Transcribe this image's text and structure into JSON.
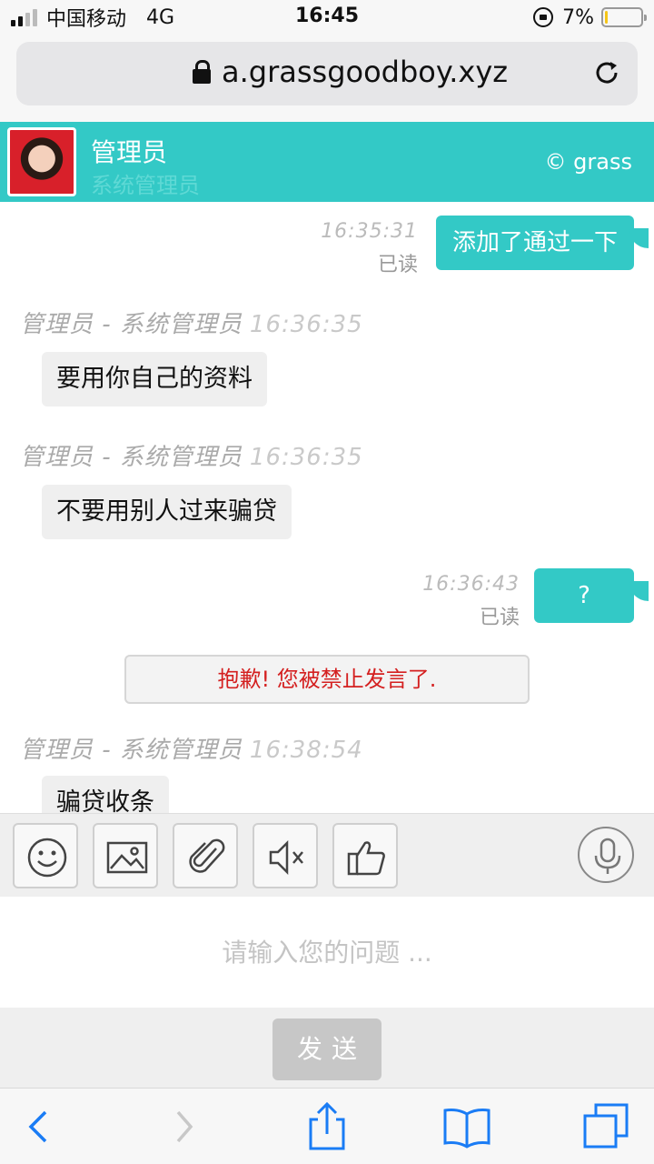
{
  "status_bar": {
    "carrier": "中国移动",
    "network": "4G",
    "time": "16:45",
    "battery_pct": "7%",
    "battery_level": 0.07,
    "signal_bars_active": 2,
    "signal_bars_total": 4
  },
  "browser": {
    "url": "a.grassgoodboy.xyz"
  },
  "chat_header": {
    "name": "管理员",
    "role": "系统管理员",
    "brand": "© grass"
  },
  "messages": [
    {
      "direction": "out",
      "time": "16:35:31",
      "status": "已读",
      "text": "添加了通过一下"
    },
    {
      "direction": "in",
      "sender": "管理员 - 系统管理员",
      "time": "16:36:35",
      "text": "要用你自己的资料"
    },
    {
      "direction": "in",
      "sender": "管理员 - 系统管理员",
      "time": "16:36:35",
      "text": "不要用别人过来骗贷"
    },
    {
      "direction": "out",
      "time": "16:36:43",
      "status": "已读",
      "text": "?"
    },
    {
      "direction": "system",
      "text": "抱歉! 您被禁止发言了."
    },
    {
      "direction": "in",
      "sender": "管理员 - 系统管理员",
      "time": "16:38:54",
      "text": "骗贷收条"
    }
  ],
  "toolbar": {
    "tools": [
      "smiley-icon",
      "image-icon",
      "paperclip-icon",
      "mute-icon",
      "thumbs-up-icon"
    ],
    "voice": "microphone-icon"
  },
  "input": {
    "placeholder": "请输入您的问题 ...",
    "value": ""
  },
  "send_label": "发送",
  "safari_bar": {
    "icons": [
      "back-icon",
      "forward-icon",
      "share-icon",
      "bookmarks-icon",
      "tabs-icon"
    ]
  },
  "colors": {
    "accent": "#33c9c6",
    "notice_text": "#d42020",
    "incoming_bubble": "#efefef"
  }
}
